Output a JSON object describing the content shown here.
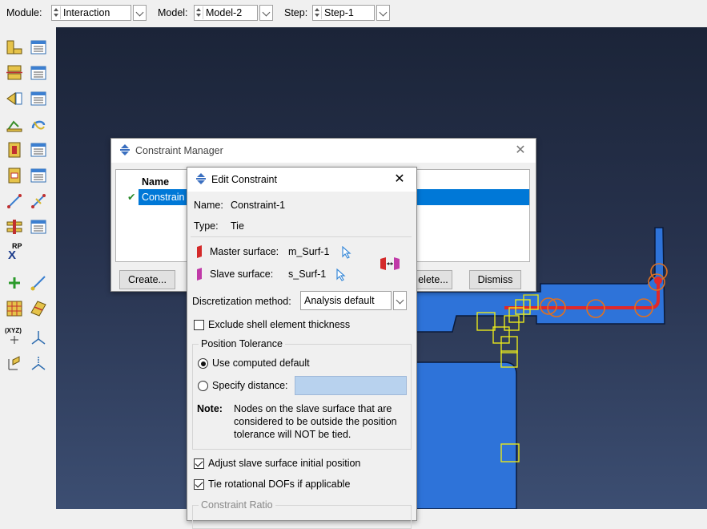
{
  "context_bar": {
    "module_label": "Module:",
    "module_value": "Interaction",
    "model_label": "Model:",
    "model_value": "Model-2",
    "step_label": "Step:",
    "step_value": "Step-1"
  },
  "constraint_manager": {
    "title": "Constraint Manager",
    "column_header": "Name",
    "row_name": "Constrain",
    "row_check": "✔",
    "create_label": "Create...",
    "delete_label": "elete...",
    "dismiss_label": "Dismiss"
  },
  "edit_constraint": {
    "title": "Edit Constraint",
    "name_label": "Name:",
    "name_value": "Constraint-1",
    "type_label": "Type:",
    "type_value": "Tie",
    "master_label": "Master surface:",
    "master_value": "m_Surf-1",
    "slave_label": "Slave surface:",
    "slave_value": "s_Surf-1",
    "discretization_label": "Discretization method:",
    "discretization_value": "Analysis default",
    "exclude_shell_label": "Exclude shell element thickness",
    "exclude_shell_checked": false,
    "position_tolerance_title": "Position Tolerance",
    "use_computed_label": "Use computed default",
    "use_computed_selected": true,
    "specify_distance_label": "Specify distance:",
    "specify_distance_value": "",
    "note_label": "Note:",
    "note_lines": [
      "Nodes on the slave surface that are",
      "considered to be outside the position",
      "tolerance will NOT be tied."
    ],
    "adjust_slave_label": "Adjust slave surface initial position",
    "adjust_slave_checked": true,
    "tie_rotational_label": "Tie rotational DOFs if applicable",
    "tie_rotational_checked": true,
    "constraint_ratio_title": "Constraint Ratio"
  },
  "toolbox": {
    "rp_label": "RP",
    "rp_axis": "X",
    "xyz_label": "(XYZ)"
  },
  "colors": {
    "viewport_top": "#1b2438",
    "viewport_bottom": "#3c4e72",
    "part_blue": "#2e73d9",
    "highlight_yellow": "#e8e81c",
    "surface_red": "#e0282a",
    "selection_blue": "#0078d7"
  }
}
